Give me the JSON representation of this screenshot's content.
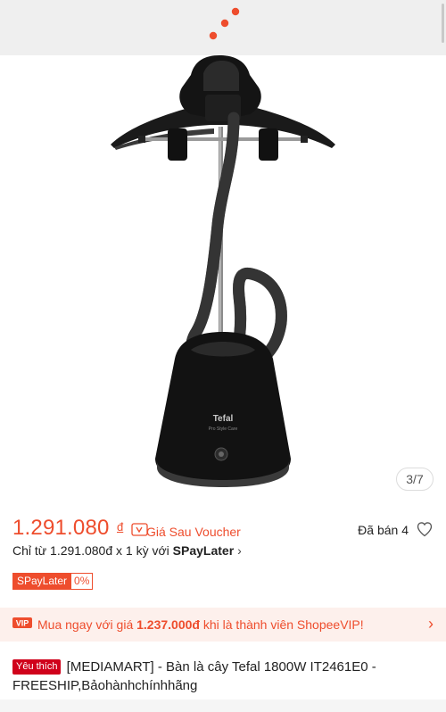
{
  "gallery": {
    "counter": "3/7",
    "image_alt": "Tefal garment steamer",
    "brand_label": "Tefal",
    "brand_sublabel": "Pro Style Care"
  },
  "price": {
    "amount": "1.291.080",
    "currency": "đ",
    "voucher_label": "Giá Sau Voucher",
    "sold": "Đã bán 4"
  },
  "installment": {
    "prefix": "Chỉ từ 1.291.080đ x 1 kỳ với ",
    "provider": "SPayLater",
    "chevron": "›"
  },
  "spaylater": {
    "name": "SPayLater",
    "rate": "0%"
  },
  "vip": {
    "text_before": "Mua ngay với giá ",
    "price": "1.237.000đ",
    "text_after": " khi là thành viên ShopeeVIP!",
    "chevron": "›"
  },
  "product": {
    "badge": "Yêu thích",
    "title": "[MEDIAMART] - Bàn là cây Tefal 1800W IT2461E0 - FREESHIP,Bảohànhchínhhãng"
  },
  "colors": {
    "accent": "#ee4d2d",
    "favorite_badge": "#d0011b",
    "vip_background": "#fdf0ec"
  }
}
